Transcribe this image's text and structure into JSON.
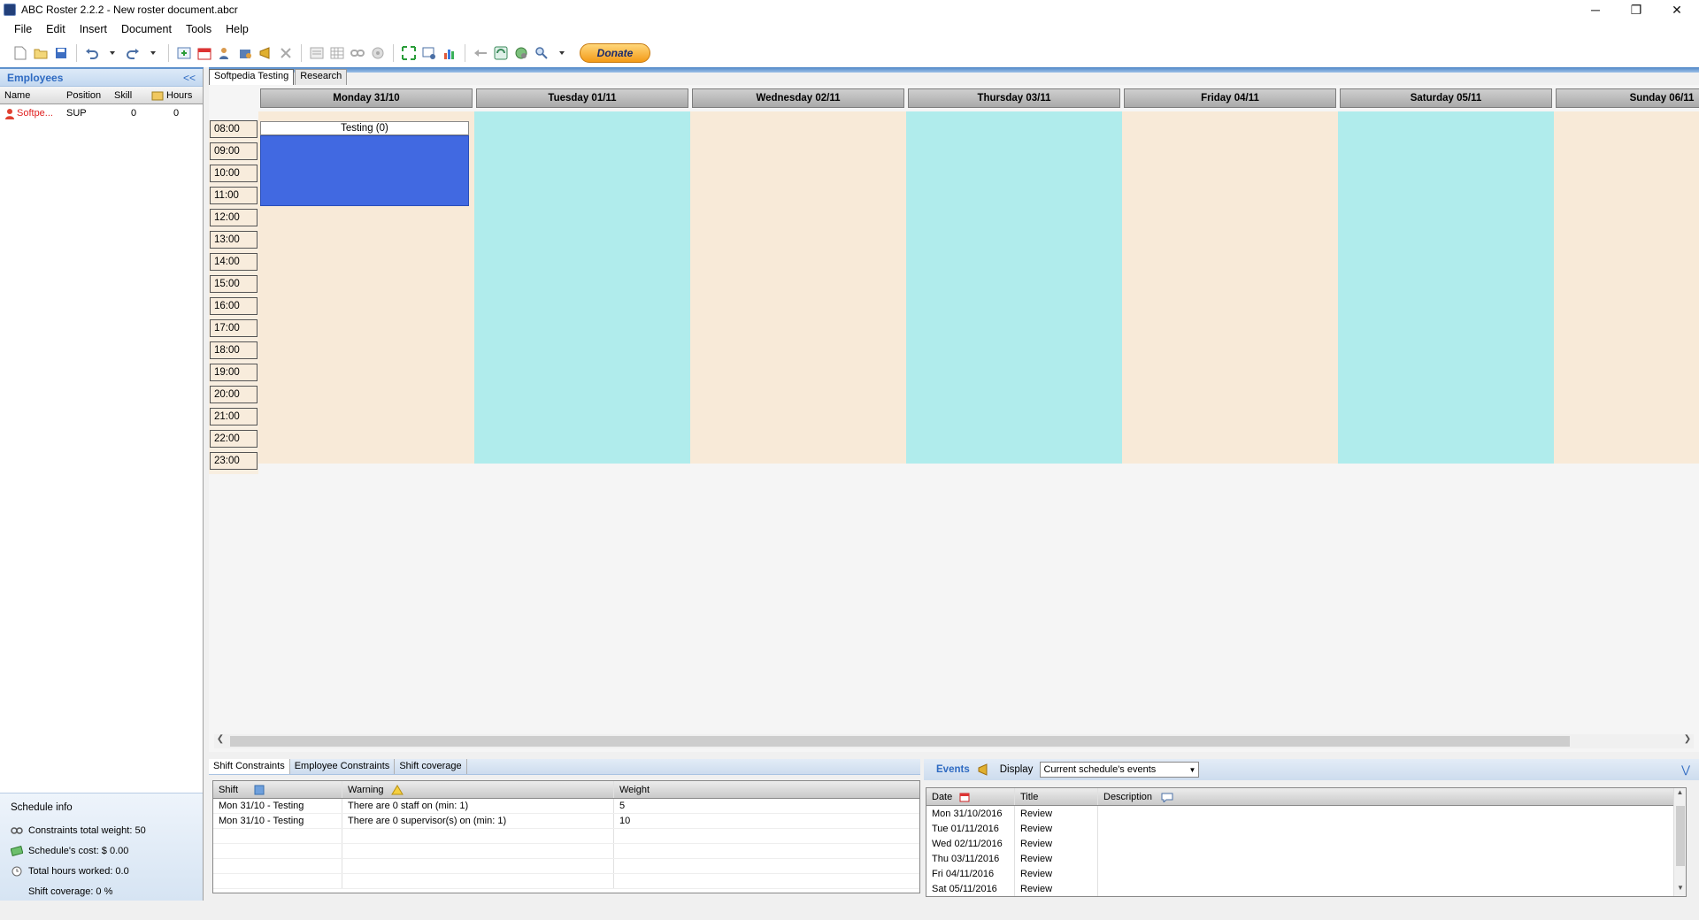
{
  "window": {
    "title": "ABC Roster 2.2.2 - New roster document.abcr",
    "controls": {
      "minimize": "─",
      "restore": "❐",
      "close": "✕"
    }
  },
  "menu": [
    "File",
    "Edit",
    "Insert",
    "Document",
    "Tools",
    "Help"
  ],
  "toolbar": {
    "donate_label": "Donate"
  },
  "employees_panel": {
    "title": "Employees",
    "collapse_glyph": "<<",
    "columns": [
      "Name",
      "Position",
      "Skill",
      "Hours"
    ],
    "rows": [
      {
        "name": "Softpe...",
        "position": "SUP",
        "skill": "0",
        "hours": "0"
      }
    ]
  },
  "schedule_info": {
    "title": "Schedule info",
    "constraints_weight": "Constraints total weight: 50",
    "cost": "Schedule's cost: $ 0.00",
    "hours_worked": "Total hours worked: 0.0",
    "coverage": "Shift coverage: 0 %"
  },
  "roster_tabs": [
    "Softpedia Testing",
    "Research"
  ],
  "days": [
    "Monday 31/10",
    "Tuesday 01/11",
    "Wednesday 02/11",
    "Thursday 03/11",
    "Friday 04/11",
    "Saturday 05/11",
    "Sunday 06/11"
  ],
  "day_colors": [
    "#f8ead8",
    "#b0ecec",
    "#f8ead8",
    "#b0ecec",
    "#f8ead8",
    "#b0ecec",
    "#f8ead8"
  ],
  "hours": [
    "08:00",
    "09:00",
    "10:00",
    "11:00",
    "12:00",
    "13:00",
    "14:00",
    "15:00",
    "16:00",
    "17:00",
    "18:00",
    "19:00",
    "20:00",
    "21:00",
    "22:00",
    "23:00"
  ],
  "shift": {
    "label": "Testing (0)",
    "color": "#4169e1"
  },
  "constraints_panel": {
    "tabs": [
      "Shift Constraints",
      "Employee Constraints",
      "Shift coverage"
    ],
    "columns": [
      "Shift",
      "Warning",
      "Weight"
    ],
    "rows": [
      {
        "shift": "Mon 31/10 - Testing",
        "warning": "There are 0 staff on (min: 1)",
        "weight": "5"
      },
      {
        "shift": "Mon 31/10 - Testing",
        "warning": "There are 0 supervisor(s) on (min: 1)",
        "weight": "10"
      }
    ]
  },
  "events_panel": {
    "title": "Events",
    "display_label": "Display",
    "display_value": "Current schedule's events",
    "columns": [
      "Date",
      "Title",
      "Description"
    ],
    "rows": [
      {
        "date": "Mon 31/10/2016",
        "title": "Review",
        "description": ""
      },
      {
        "date": "Tue 01/11/2016",
        "title": "Review",
        "description": ""
      },
      {
        "date": "Wed 02/11/2016",
        "title": "Review",
        "description": ""
      },
      {
        "date": "Thu 03/11/2016",
        "title": "Review",
        "description": ""
      },
      {
        "date": "Fri 04/11/2016",
        "title": "Review",
        "description": ""
      },
      {
        "date": "Sat 05/11/2016",
        "title": "Review",
        "description": ""
      }
    ]
  }
}
